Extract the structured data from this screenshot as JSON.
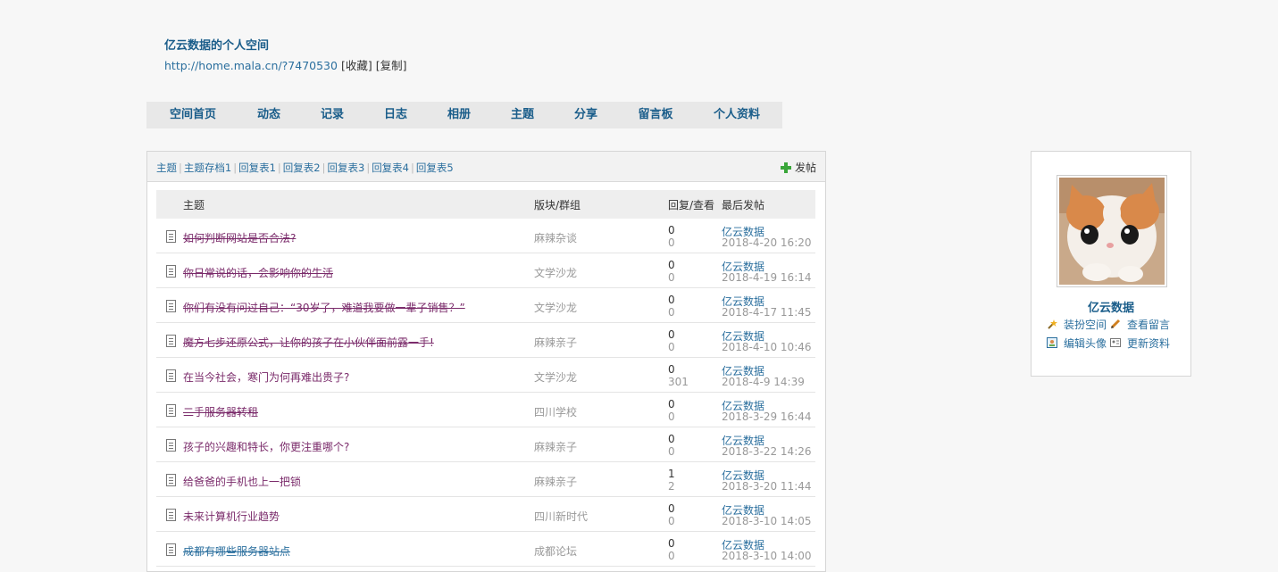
{
  "header": {
    "site_title": "亿云数据的个人空间",
    "url": "http://home.mala.cn/?7470530",
    "bookmark": "收藏",
    "copy": "复制"
  },
  "nav": [
    {
      "label": "空间首页"
    },
    {
      "label": "动态"
    },
    {
      "label": "记录"
    },
    {
      "label": "日志"
    },
    {
      "label": "相册"
    },
    {
      "label": "主题"
    },
    {
      "label": "分享"
    },
    {
      "label": "留言板"
    },
    {
      "label": "个人资料"
    }
  ],
  "subnav": {
    "tabs": [
      "主题",
      "主题存档1",
      "回复表1",
      "回复表2",
      "回复表3",
      "回复表4",
      "回复表5"
    ],
    "post_button": "发帖"
  },
  "table": {
    "headers": {
      "title": "主题",
      "forum": "版块/群组",
      "stats": "回复/查看",
      "last": "最后发帖"
    },
    "rows": [
      {
        "title": "如何判断网站是否合法?",
        "strike": true,
        "color": "#7a2a6a",
        "forum": "麻辣杂谈",
        "replies": "0",
        "views": "0",
        "last_user": "亿云数据",
        "last_date": "2018-4-20 16:20"
      },
      {
        "title": "你日常说的话，会影响你的生活",
        "strike": true,
        "color": "#7a2a6a",
        "forum": "文学沙龙",
        "replies": "0",
        "views": "0",
        "last_user": "亿云数据",
        "last_date": "2018-4-19 16:14"
      },
      {
        "title": "你们有没有问过自己：“30岁了，难道我要做一辈子销售？”",
        "strike": true,
        "color": "#7a2a6a",
        "forum": "文学沙龙",
        "replies": "0",
        "views": "0",
        "last_user": "亿云数据",
        "last_date": "2018-4-17 11:45"
      },
      {
        "title": "魔方七步还原公式，让你的孩子在小伙伴面前露一手!",
        "strike": true,
        "color": "#7a2a6a",
        "forum": "麻辣亲子",
        "replies": "0",
        "views": "0",
        "last_user": "亿云数据",
        "last_date": "2018-4-10 10:46"
      },
      {
        "title": "在当今社会，寒门为何再难出贵子?",
        "strike": false,
        "color": "#7a2a6a",
        "forum": "文学沙龙",
        "replies": "0",
        "views": "301",
        "last_user": "亿云数据",
        "last_date": "2018-4-9 14:39"
      },
      {
        "title": "二手服务器转租",
        "strike": true,
        "color": "#7a2a6a",
        "forum": "四川学校",
        "replies": "0",
        "views": "0",
        "last_user": "亿云数据",
        "last_date": "2018-3-29 16:44"
      },
      {
        "title": "孩子的兴趣和特长，你更注重哪个?",
        "strike": false,
        "color": "#7a2a6a",
        "forum": "麻辣亲子",
        "replies": "0",
        "views": "0",
        "last_user": "亿云数据",
        "last_date": "2018-3-22 14:26"
      },
      {
        "title": "给爸爸的手机也上一把锁",
        "strike": false,
        "color": "#7a2a6a",
        "forum": "麻辣亲子",
        "replies": "1",
        "views": "2",
        "last_user": "亿云数据",
        "last_date": "2018-3-20 11:44"
      },
      {
        "title": "未来计算机行业趋势",
        "strike": false,
        "color": "#7a2a6a",
        "forum": "四川新时代",
        "replies": "0",
        "views": "0",
        "last_user": "亿云数据",
        "last_date": "2018-3-10 14:05"
      },
      {
        "title": "成都有哪些服务器站点",
        "strike": true,
        "color": "#2b6f9e",
        "forum": "成都论坛",
        "replies": "0",
        "views": "0",
        "last_user": "亿云数据",
        "last_date": "2018-3-10 14:00"
      }
    ]
  },
  "profile": {
    "username": "亿云数据",
    "actions": {
      "decorate": "装扮空间",
      "view_messages": "查看留言",
      "edit_avatar": "编辑头像",
      "update_profile": "更新资料"
    }
  },
  "colors": {
    "link": "#2b6f9e",
    "title_visited": "#7a2a6a",
    "nav_bg": "#e8e8e8",
    "header_bg": "#eeeeee"
  }
}
